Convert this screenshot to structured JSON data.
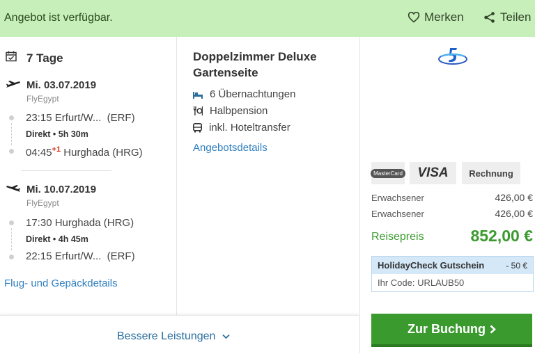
{
  "header": {
    "status": "Angebot ist verfügbar.",
    "save_label": "Merken",
    "share_label": "Teilen"
  },
  "flights": {
    "duration": "7 Tage",
    "outbound": {
      "date": "Mi. 03.07.2019",
      "airline": "FlyEgypt",
      "dep_time": "23:15",
      "dep_place": "Erfurt/W...",
      "dep_code": "(ERF)",
      "info": "Direkt • 5h 30m",
      "arr_time": "04:45",
      "arr_dayoffset": "+1",
      "arr_place": "Hurghada (HRG)"
    },
    "inbound": {
      "date": "Mi. 10.07.2019",
      "airline": "FlyEgypt",
      "dep_time": "17:30",
      "dep_place": "Hurghada (HRG)",
      "info": "Direkt • 4h 45m",
      "arr_time": "22:15",
      "arr_place": "Erfurt/W...",
      "arr_code": "(ERF)"
    },
    "details_link": "Flug- und Gepäckdetails"
  },
  "room": {
    "title_line1": "Doppelzimmer Deluxe",
    "title_line2": "Gartenseite",
    "features": [
      "6 Übernachtungen",
      "Halbpension",
      "inkl. Hoteltransfer"
    ],
    "details_link": "Angebotsdetails"
  },
  "pricing": {
    "payment_methods": [
      "MasterCard",
      "VISA",
      "Rechnung"
    ],
    "rows": [
      {
        "label": "Erwachsener",
        "value": "426,00 €"
      },
      {
        "label": "Erwachsener",
        "value": "426,00 €"
      }
    ],
    "total_label": "Reisepreis",
    "total_value": "852,00 €",
    "voucher_title": "HolidayCheck Gutschein",
    "voucher_amount": "- 50 €",
    "voucher_code": "Ihr Code: URLAUB50",
    "book_button": "Zur Buchung"
  },
  "footer": {
    "more_services": "Bessere Leistungen"
  },
  "colors": {
    "header_bg": "#c6efb9",
    "link": "#2f7fbf",
    "price_green": "#3a9a2e",
    "button_green": "#3a9a2e"
  }
}
